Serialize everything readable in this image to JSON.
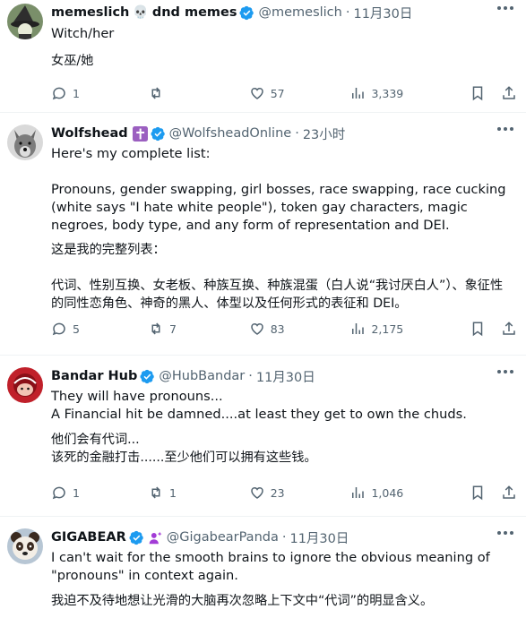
{
  "posts": [
    {
      "name": "memeslich",
      "name_suffix": "dnd memes",
      "emoji": "💀",
      "handle": "@memeslich",
      "time": "11月30日",
      "text": "Witch/her",
      "translation": "女巫/她",
      "reply_count": "1",
      "retweet_count": "",
      "like_count": "57",
      "view_count": "3,339"
    },
    {
      "name": "Wolfshead",
      "badge_icon": "cross-icon",
      "handle": "@WolfsheadOnline",
      "time": "23小时",
      "text": "Here's my complete list:\n\nPronouns, gender swapping, girl bosses, race swapping, race cucking (white says \"I hate white people\"), token gay characters, magic negroes, body type, and any form of representation and DEI.",
      "translation": "这是我的完整列表：\n\n代词、性别互换、女老板、种族互换、种族混蛋（白人说“我讨厌白人”）、象征性的同性恋角色、神奇的黑人、体型以及任何形式的表征和 DEI。",
      "reply_count": "5",
      "retweet_count": "7",
      "like_count": "83",
      "view_count": "2,175"
    },
    {
      "name": "Bandar Hub",
      "handle": "@HubBandar",
      "time": "11月30日",
      "text": "They will have pronouns...\nA Financial hit be damned....at least they get to own the chuds.",
      "translation": "他们会有代词...\n该死的金融打击......至少他们可以拥有这些钱。",
      "reply_count": "1",
      "retweet_count": "1",
      "like_count": "23",
      "view_count": "1,046"
    },
    {
      "name": "GIGABEAR",
      "badge_icon": "person-sparkle-icon",
      "handle": "@GigabearPanda",
      "time": "11月30日",
      "text": "I can't wait for the smooth brains to ignore the obvious meaning of \"pronouns\" in context again.",
      "translation": "我迫不及待地想让光滑的大脑再次忽略上下文中“代词”的明显含义。"
    }
  ],
  "colors": {
    "text": "#0f1419",
    "secondary": "#536471",
    "verified": "#1d9bf0",
    "divider": "#eff3f4"
  }
}
